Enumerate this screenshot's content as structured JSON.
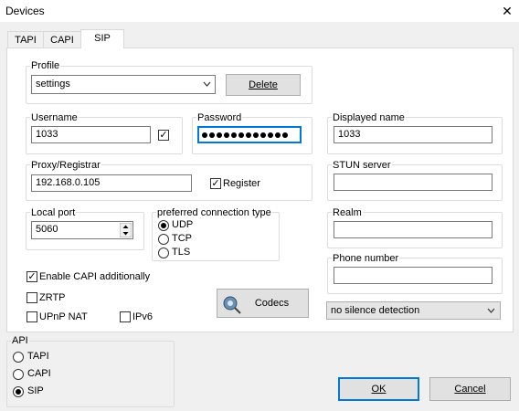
{
  "window": {
    "title": "Devices",
    "close_glyph": "✕"
  },
  "tabs": [
    {
      "label": "TAPI",
      "active": false
    },
    {
      "label": "CAPI",
      "active": false
    },
    {
      "label": "SIP",
      "active": true
    }
  ],
  "profile": {
    "label": "Profile",
    "value": "settings",
    "delete_label": "Delete"
  },
  "username": {
    "label": "Username",
    "value": "1033",
    "checked": true
  },
  "password": {
    "label": "Password",
    "masked_length": 12
  },
  "displayed_name": {
    "label": "Displayed name",
    "value": "1033"
  },
  "proxy": {
    "label": "Proxy/Registrar",
    "value": "192.168.0.105",
    "register_label": "Register",
    "register_checked": true
  },
  "stun": {
    "label": "STUN server",
    "value": ""
  },
  "local_port": {
    "label": "Local port",
    "value": "5060"
  },
  "connection_type": {
    "label": "preferred connection type",
    "options": [
      "UDP",
      "TCP",
      "TLS"
    ],
    "selected": "UDP"
  },
  "realm": {
    "label": "Realm",
    "value": ""
  },
  "phone_number": {
    "label": "Phone number",
    "value": ""
  },
  "options": {
    "enable_capi": {
      "label": "Enable CAPI additionally",
      "checked": true
    },
    "zrtp": {
      "label": "ZRTP",
      "checked": false
    },
    "upnp": {
      "label": "UPnP NAT",
      "checked": false
    },
    "ipv6": {
      "label": "IPv6",
      "checked": false
    }
  },
  "codecs_label": "Codecs",
  "silence_detection": {
    "value": "no silence detection"
  },
  "api": {
    "label": "API",
    "options": [
      "TAPI",
      "CAPI",
      "SIP"
    ],
    "selected": "SIP"
  },
  "buttons": {
    "ok": "OK",
    "cancel": "Cancel"
  },
  "colors": {
    "focus_border": "#0078d7",
    "window_bg": "#f0f0f0"
  }
}
